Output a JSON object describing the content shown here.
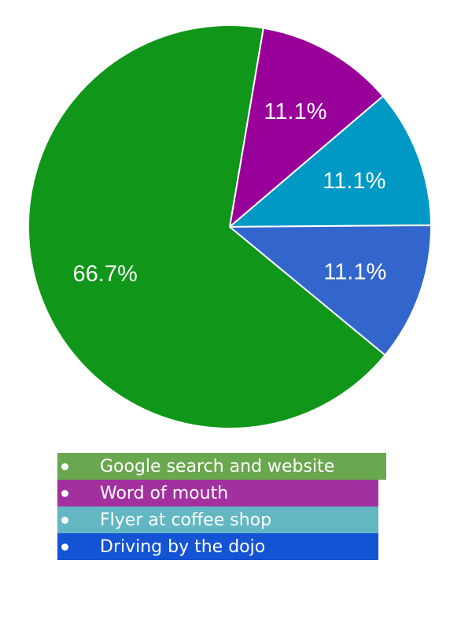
{
  "chart_data": {
    "type": "pie",
    "categories": [
      "Google search and website",
      "Word of mouth",
      "Flyer at coffee shop",
      "Driving by the dojo"
    ],
    "values": [
      66.7,
      11.1,
      11.1,
      11.1
    ],
    "data_labels": [
      "66.7%",
      "11.1%",
      "11.1%",
      "11.1%"
    ],
    "slice_colors": [
      "#109618",
      "#990099",
      "#0099c6",
      "#3366cc"
    ],
    "legend_colors": [
      "#6aa84f",
      "#a2309f",
      "#63b7c3",
      "#1453d4"
    ],
    "legend_placement": "bottom"
  }
}
